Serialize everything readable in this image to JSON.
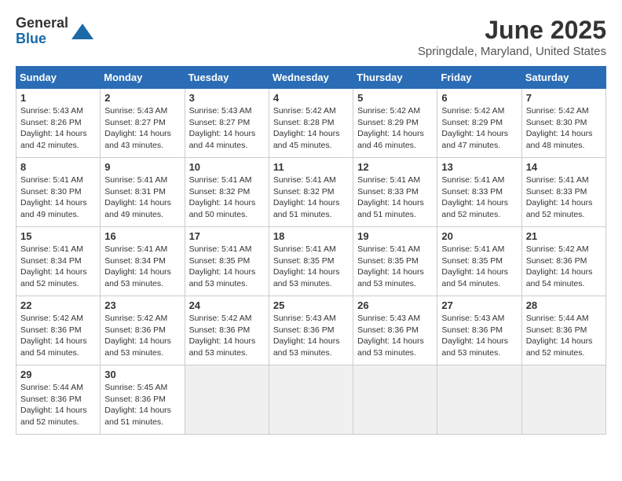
{
  "header": {
    "logo_general": "General",
    "logo_blue": "Blue",
    "month_title": "June 2025",
    "location": "Springdale, Maryland, United States"
  },
  "weekdays": [
    "Sunday",
    "Monday",
    "Tuesday",
    "Wednesday",
    "Thursday",
    "Friday",
    "Saturday"
  ],
  "weeks": [
    [
      {
        "day": "1",
        "info": "Sunrise: 5:43 AM\nSunset: 8:26 PM\nDaylight: 14 hours\nand 42 minutes."
      },
      {
        "day": "2",
        "info": "Sunrise: 5:43 AM\nSunset: 8:27 PM\nDaylight: 14 hours\nand 43 minutes."
      },
      {
        "day": "3",
        "info": "Sunrise: 5:43 AM\nSunset: 8:27 PM\nDaylight: 14 hours\nand 44 minutes."
      },
      {
        "day": "4",
        "info": "Sunrise: 5:42 AM\nSunset: 8:28 PM\nDaylight: 14 hours\nand 45 minutes."
      },
      {
        "day": "5",
        "info": "Sunrise: 5:42 AM\nSunset: 8:29 PM\nDaylight: 14 hours\nand 46 minutes."
      },
      {
        "day": "6",
        "info": "Sunrise: 5:42 AM\nSunset: 8:29 PM\nDaylight: 14 hours\nand 47 minutes."
      },
      {
        "day": "7",
        "info": "Sunrise: 5:42 AM\nSunset: 8:30 PM\nDaylight: 14 hours\nand 48 minutes."
      }
    ],
    [
      {
        "day": "8",
        "info": "Sunrise: 5:41 AM\nSunset: 8:30 PM\nDaylight: 14 hours\nand 49 minutes."
      },
      {
        "day": "9",
        "info": "Sunrise: 5:41 AM\nSunset: 8:31 PM\nDaylight: 14 hours\nand 49 minutes."
      },
      {
        "day": "10",
        "info": "Sunrise: 5:41 AM\nSunset: 8:32 PM\nDaylight: 14 hours\nand 50 minutes."
      },
      {
        "day": "11",
        "info": "Sunrise: 5:41 AM\nSunset: 8:32 PM\nDaylight: 14 hours\nand 51 minutes."
      },
      {
        "day": "12",
        "info": "Sunrise: 5:41 AM\nSunset: 8:33 PM\nDaylight: 14 hours\nand 51 minutes."
      },
      {
        "day": "13",
        "info": "Sunrise: 5:41 AM\nSunset: 8:33 PM\nDaylight: 14 hours\nand 52 minutes."
      },
      {
        "day": "14",
        "info": "Sunrise: 5:41 AM\nSunset: 8:33 PM\nDaylight: 14 hours\nand 52 minutes."
      }
    ],
    [
      {
        "day": "15",
        "info": "Sunrise: 5:41 AM\nSunset: 8:34 PM\nDaylight: 14 hours\nand 52 minutes."
      },
      {
        "day": "16",
        "info": "Sunrise: 5:41 AM\nSunset: 8:34 PM\nDaylight: 14 hours\nand 53 minutes."
      },
      {
        "day": "17",
        "info": "Sunrise: 5:41 AM\nSunset: 8:35 PM\nDaylight: 14 hours\nand 53 minutes."
      },
      {
        "day": "18",
        "info": "Sunrise: 5:41 AM\nSunset: 8:35 PM\nDaylight: 14 hours\nand 53 minutes."
      },
      {
        "day": "19",
        "info": "Sunrise: 5:41 AM\nSunset: 8:35 PM\nDaylight: 14 hours\nand 53 minutes."
      },
      {
        "day": "20",
        "info": "Sunrise: 5:41 AM\nSunset: 8:35 PM\nDaylight: 14 hours\nand 54 minutes."
      },
      {
        "day": "21",
        "info": "Sunrise: 5:42 AM\nSunset: 8:36 PM\nDaylight: 14 hours\nand 54 minutes."
      }
    ],
    [
      {
        "day": "22",
        "info": "Sunrise: 5:42 AM\nSunset: 8:36 PM\nDaylight: 14 hours\nand 54 minutes."
      },
      {
        "day": "23",
        "info": "Sunrise: 5:42 AM\nSunset: 8:36 PM\nDaylight: 14 hours\nand 53 minutes."
      },
      {
        "day": "24",
        "info": "Sunrise: 5:42 AM\nSunset: 8:36 PM\nDaylight: 14 hours\nand 53 minutes."
      },
      {
        "day": "25",
        "info": "Sunrise: 5:43 AM\nSunset: 8:36 PM\nDaylight: 14 hours\nand 53 minutes."
      },
      {
        "day": "26",
        "info": "Sunrise: 5:43 AM\nSunset: 8:36 PM\nDaylight: 14 hours\nand 53 minutes."
      },
      {
        "day": "27",
        "info": "Sunrise: 5:43 AM\nSunset: 8:36 PM\nDaylight: 14 hours\nand 53 minutes."
      },
      {
        "day": "28",
        "info": "Sunrise: 5:44 AM\nSunset: 8:36 PM\nDaylight: 14 hours\nand 52 minutes."
      }
    ],
    [
      {
        "day": "29",
        "info": "Sunrise: 5:44 AM\nSunset: 8:36 PM\nDaylight: 14 hours\nand 52 minutes."
      },
      {
        "day": "30",
        "info": "Sunrise: 5:45 AM\nSunset: 8:36 PM\nDaylight: 14 hours\nand 51 minutes."
      },
      {
        "day": "",
        "info": ""
      },
      {
        "day": "",
        "info": ""
      },
      {
        "day": "",
        "info": ""
      },
      {
        "day": "",
        "info": ""
      },
      {
        "day": "",
        "info": ""
      }
    ]
  ]
}
